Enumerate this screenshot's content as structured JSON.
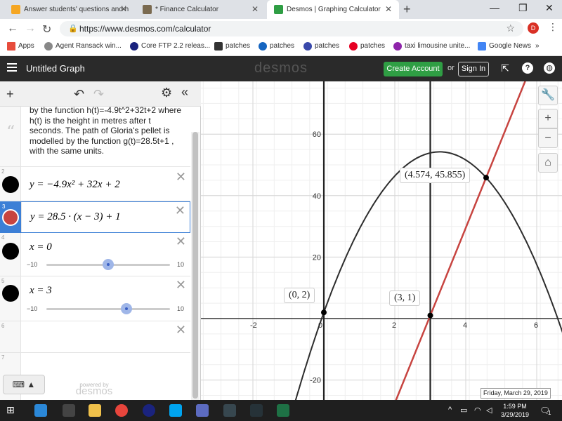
{
  "browser": {
    "tabs": [
      {
        "title": "Answer students' questions and h",
        "active": false
      },
      {
        "title": "* Finance Calculator",
        "active": false
      },
      {
        "title": "Desmos | Graphing Calculator",
        "active": true
      }
    ],
    "url": "https://www.desmos.com/calculator",
    "profile_initial": "D",
    "bookmarks": [
      "Apps",
      "Agent Ransack win...",
      "Core FTP 2.2 releas...",
      "patches",
      "patches",
      "patches",
      "patches",
      "taxi limousine unite...",
      "Google News"
    ],
    "overflow": "»"
  },
  "desmos_header": {
    "graph_title": "Untitled Graph",
    "logo": "desmos",
    "create_account": "Create Account",
    "or": "or",
    "sign_in": "Sign In"
  },
  "expressions": {
    "note_text": "by the function h(t)=-4.9t^2+32t+2 where h(t) is the height in metres after t seconds. The path of Gloria's pellet is modelled by the function g(t)=28.5t+1 , with the same units.",
    "rows": [
      {
        "num": "2",
        "latex": "y = −4.9x² + 32x + 2",
        "color": "#000000"
      },
      {
        "num": "3",
        "latex": "y = 28.5 · (x − 3) + 1",
        "color": "#c74440"
      },
      {
        "num": "4",
        "latex": "x = 0",
        "slider_min": "−10",
        "slider_max": "10",
        "slider_value": 0
      },
      {
        "num": "5",
        "latex": "x = 3",
        "slider_min": "−10",
        "slider_max": "10",
        "slider_value": 3
      },
      {
        "num": "6"
      },
      {
        "num": "7"
      }
    ],
    "keyboard_label": "⌨ ▲",
    "powered_by": "powered by",
    "powered_logo": "desmos"
  },
  "graph": {
    "x_ticks": [
      "-2",
      "0",
      "2",
      "4",
      "6"
    ],
    "y_ticks": [
      "60",
      "40",
      "20",
      "-20"
    ],
    "points": [
      {
        "label": "(4.574, 45.855)",
        "x": 4.574,
        "y": 45.855
      },
      {
        "label": "(0, 2)",
        "x": 0,
        "y": 2
      },
      {
        "label": "(3, 1)",
        "x": 3,
        "y": 1
      }
    ],
    "tooltip": "Friday, March 29, 2019"
  },
  "taskbar": {
    "time": "1:59 PM",
    "date": "3/29/2019",
    "notifications": "1"
  },
  "colors": {
    "curve_black": "#2d2d2d",
    "line_red": "#c74440",
    "accent_green": "#2f9e44"
  }
}
